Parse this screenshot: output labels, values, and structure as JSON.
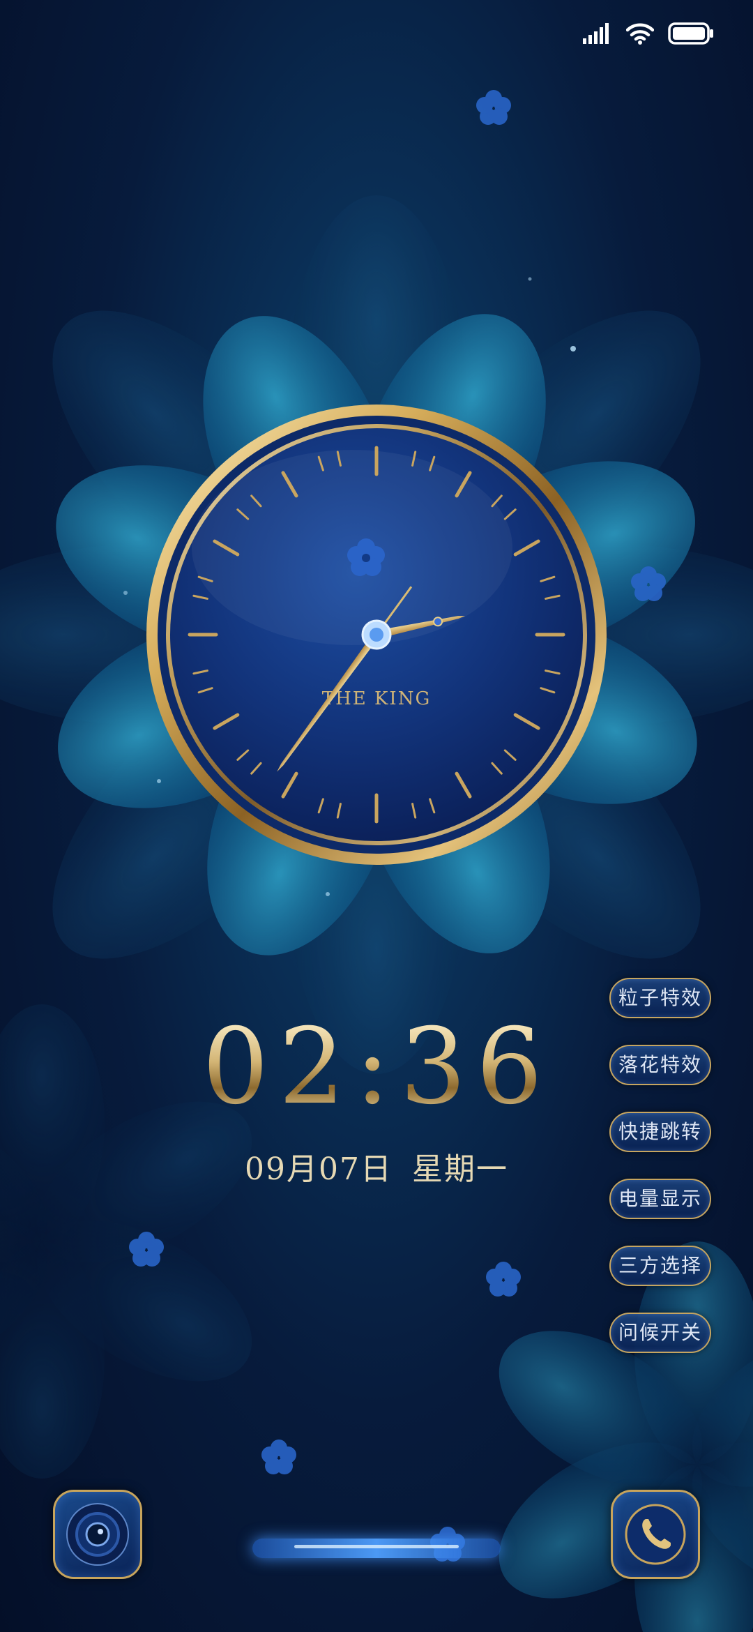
{
  "status_bar": {
    "icons": [
      "signal-icon",
      "wifi-icon",
      "battery-icon"
    ],
    "battery_level": 1.0
  },
  "clock": {
    "brand": "THE KING",
    "hour": 2,
    "minute": 36
  },
  "digital_time": "02:36",
  "date": {
    "day": "09月07日",
    "weekday": "星期一"
  },
  "side_buttons": [
    {
      "label": "粒子特效"
    },
    {
      "label": "落花特效"
    },
    {
      "label": "快捷跳转"
    },
    {
      "label": "电量显示"
    },
    {
      "label": "三方选择"
    },
    {
      "label": "问候开关"
    }
  ],
  "shortcuts": {
    "left": "camera-icon",
    "right": "phone-icon"
  },
  "colors": {
    "gold": "#c7a45c",
    "dial_blue": "#0f2d6e",
    "background": "#071b3c"
  }
}
